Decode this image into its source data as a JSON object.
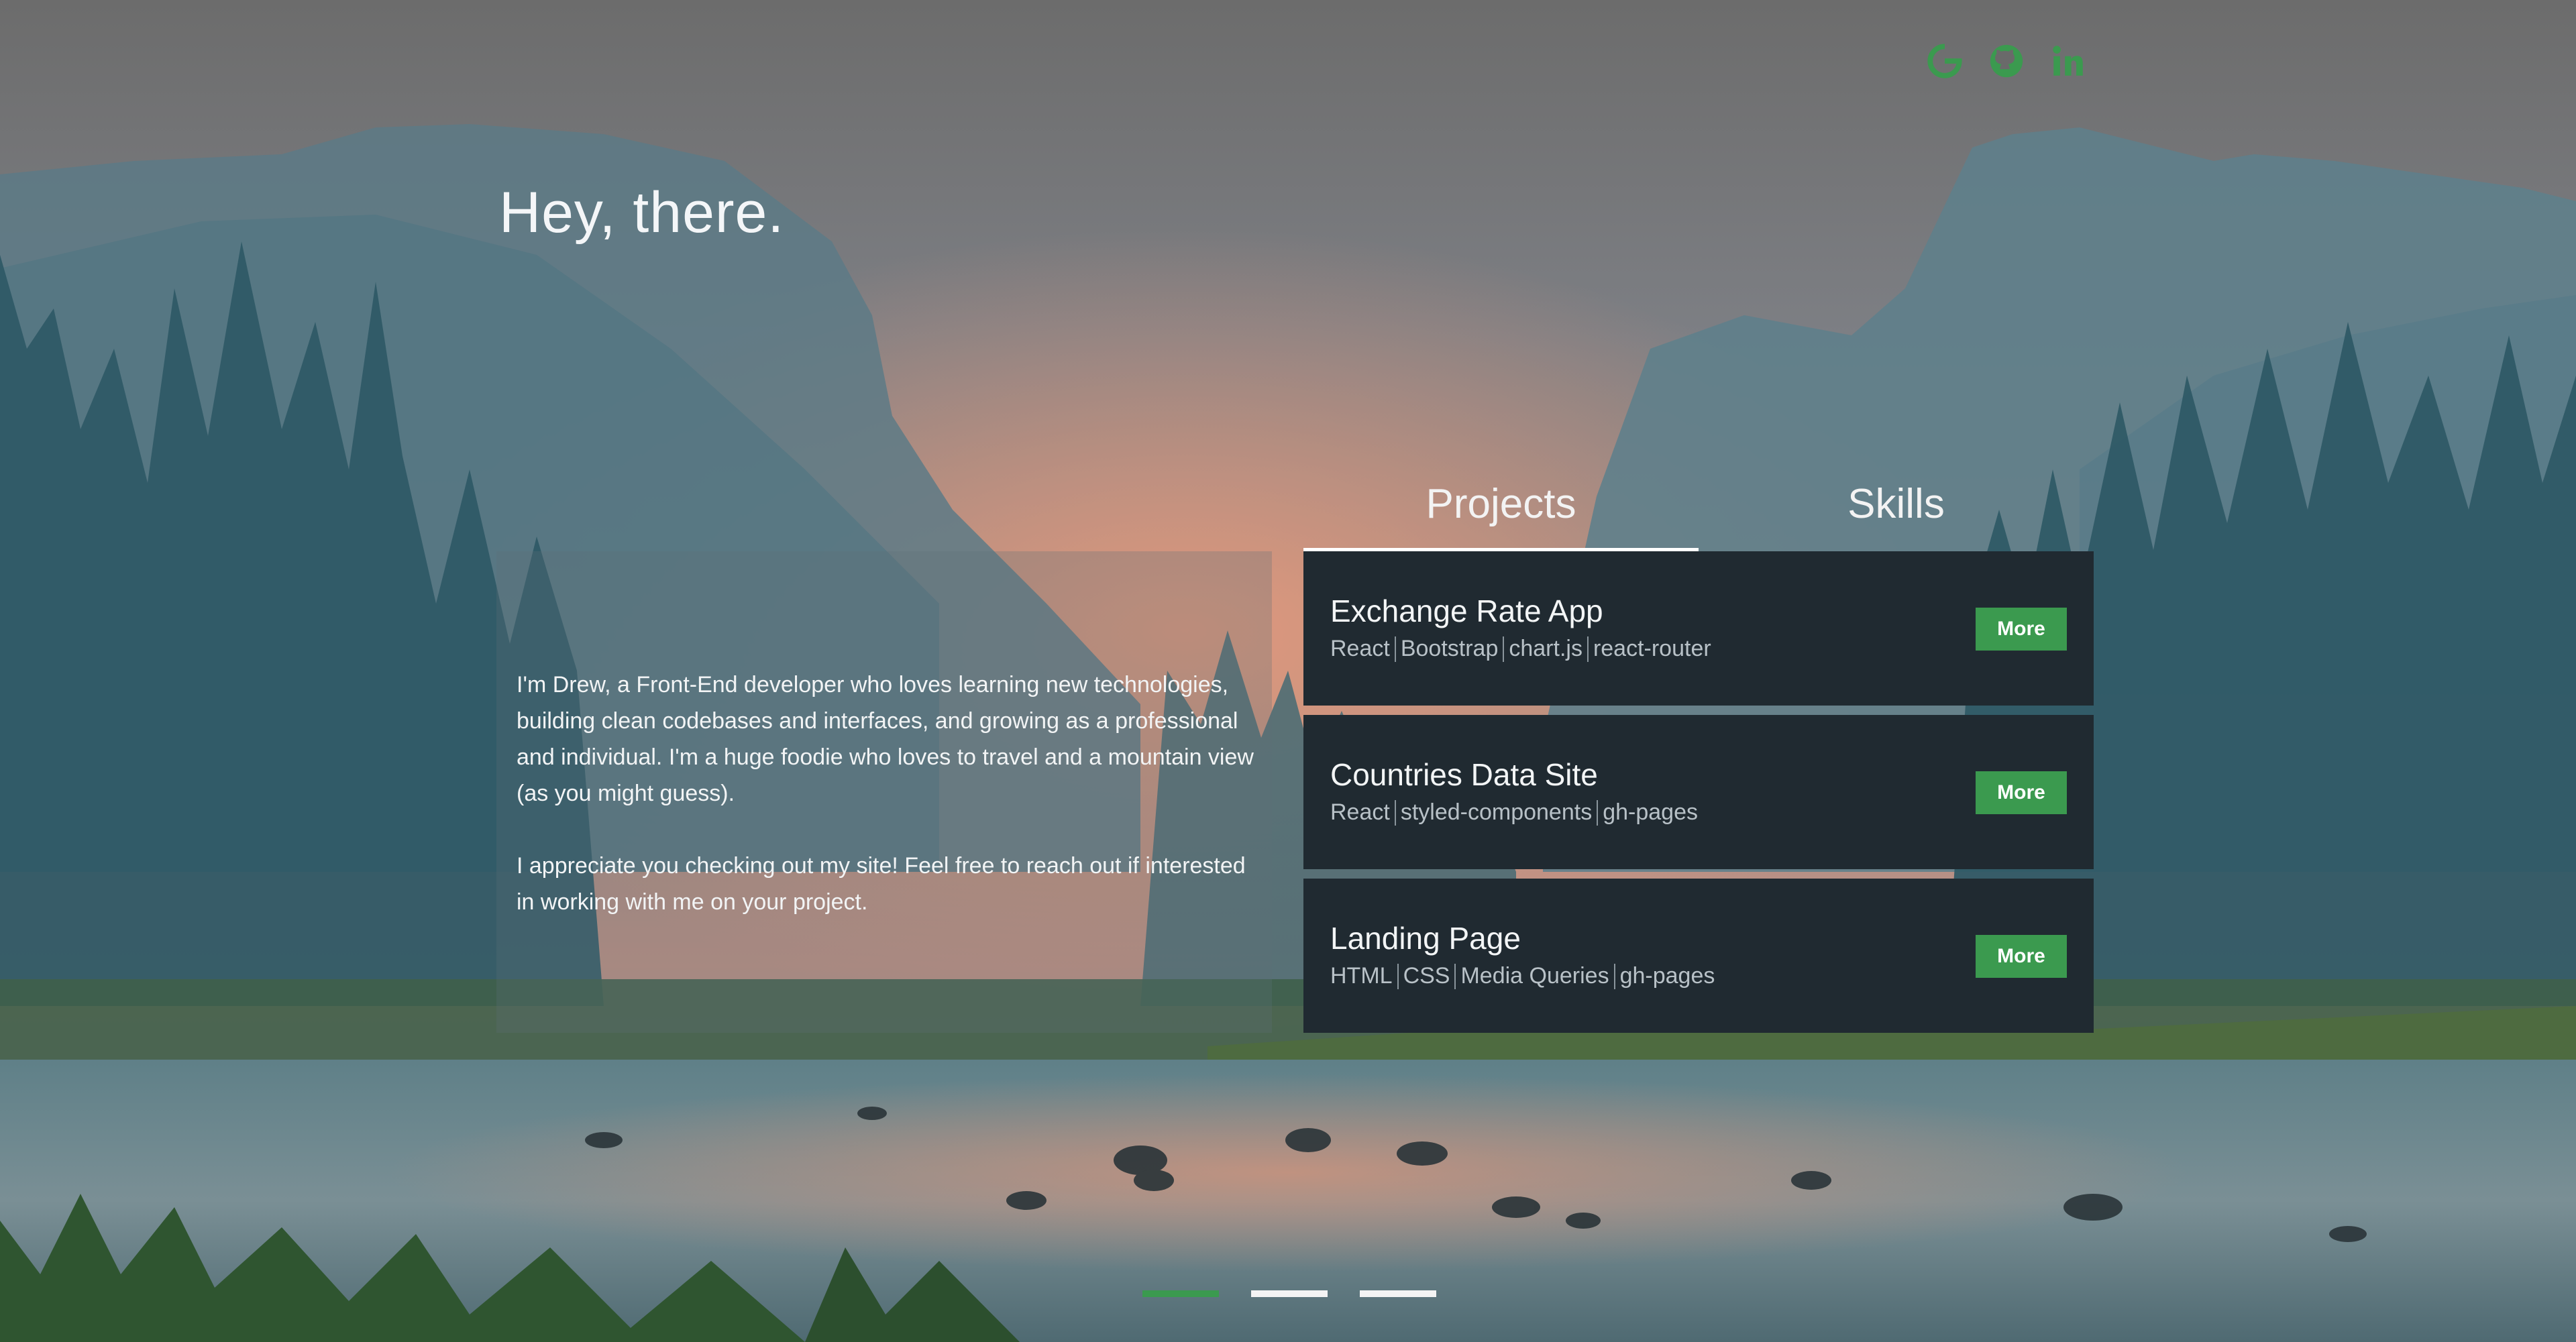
{
  "header": {
    "icons": [
      {
        "name": "google-icon",
        "color": "#3b9a4f"
      },
      {
        "name": "github-icon",
        "color": "#3b9a4f"
      },
      {
        "name": "linkedin-icon",
        "color": "#3b9a4f",
        "text": "in"
      }
    ]
  },
  "greeting": "Hey, there.",
  "about": {
    "paragraph1": "I'm Drew, a Front-End developer who loves learning new technologies, building clean codebases and interfaces, and growing as a professional and individual. I'm a huge foodie who loves to travel and a mountain view (as you might guess).",
    "paragraph2": "I appreciate you checking out my site! Feel free to reach out if interested in working with me on your project."
  },
  "tabs": [
    {
      "label": "Projects",
      "active": true
    },
    {
      "label": "Skills",
      "active": false
    }
  ],
  "projects": [
    {
      "title": "Exchange Rate App",
      "tags": [
        "React",
        "Bootstrap",
        "chart.js",
        "react-router"
      ],
      "button": "More"
    },
    {
      "title": "Countries Data Site",
      "tags": [
        "React",
        "styled-components",
        "gh-pages"
      ],
      "button": "More"
    },
    {
      "title": "Landing Page",
      "tags": [
        "HTML",
        "CSS",
        "Media Queries",
        "gh-pages"
      ],
      "button": "More"
    }
  ],
  "pager": {
    "pages": 3,
    "active_index": 0
  },
  "colors": {
    "accent": "#3b9a4f",
    "card_bg": "#202a31"
  }
}
